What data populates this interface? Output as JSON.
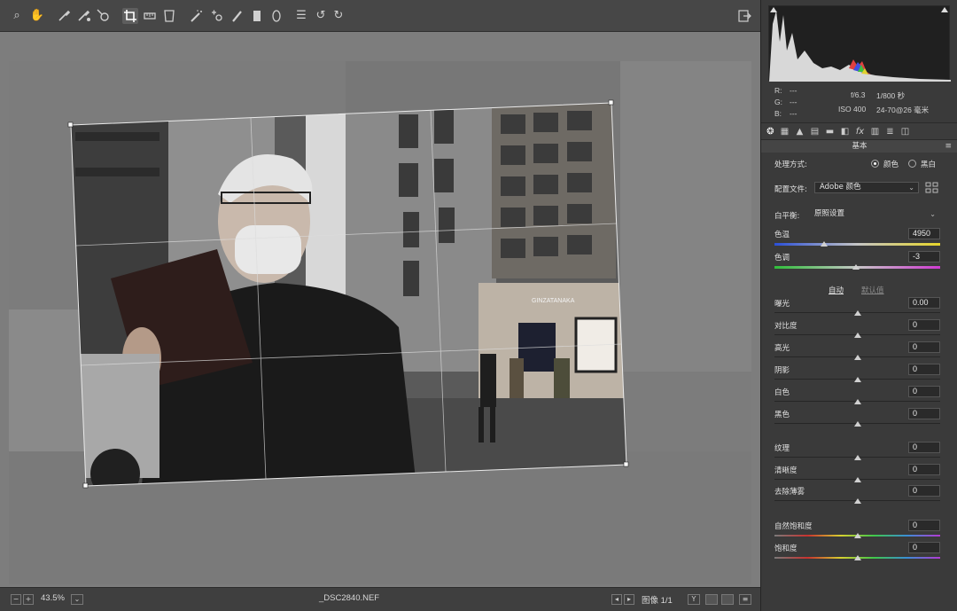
{
  "toolbar": {
    "tools": [
      {
        "name": "zoom-tool",
        "glyph": "⌕"
      },
      {
        "name": "hand-tool",
        "glyph": "✋"
      },
      {
        "name": "white-balance-tool",
        "glyph": "⟋"
      },
      {
        "name": "color-sampler-tool",
        "glyph": "⟋"
      },
      {
        "name": "targeted-adjustment-tool",
        "glyph": "⊹"
      },
      {
        "name": "crop-tool",
        "glyph": "⌗"
      },
      {
        "name": "straighten-tool",
        "glyph": "▭"
      },
      {
        "name": "transform-tool",
        "glyph": "⧈"
      },
      {
        "name": "spot-removal-tool",
        "glyph": "✎"
      },
      {
        "name": "red-eye-tool",
        "glyph": "⊕"
      },
      {
        "name": "adjustment-brush-tool",
        "glyph": "✐"
      },
      {
        "name": "graduated-filter-tool",
        "glyph": "▮"
      },
      {
        "name": "radial-filter-tool",
        "glyph": "◯"
      },
      {
        "name": "preferences-tool",
        "glyph": "☰"
      },
      {
        "name": "rotate-left-tool",
        "glyph": "↺"
      },
      {
        "name": "rotate-right-tool",
        "glyph": "↻"
      }
    ],
    "export_icon": "⇥"
  },
  "status": {
    "zoom": "43.5%",
    "filename": "_DSC2840.NEF",
    "image_counter": "图像 1/1"
  },
  "info": {
    "r": "R:",
    "g": "G:",
    "b": "B:",
    "r_val": "---",
    "g_val": "---",
    "b_val": "---",
    "aperture": "f/6.3",
    "shutter": "1/800 秒",
    "iso": "ISO 400",
    "lens": "24-70@26 毫米"
  },
  "panel": {
    "section_title": "基本",
    "treatment_label": "处理方式:",
    "treatment_color": "颜色",
    "treatment_bw": "黑白",
    "profile_label": "配置文件:",
    "profile_value": "Adobe 颜色",
    "wb_label": "白平衡:",
    "wb_value": "原照设置",
    "auto": "自动",
    "default": "默认值"
  },
  "sliders": [
    {
      "id": "temp",
      "label": "色温",
      "value": "4950",
      "frac": 0.3
    },
    {
      "id": "tint",
      "label": "色调",
      "value": "-3",
      "frac": 0.49
    },
    {
      "id": "exposure",
      "label": "曝光",
      "value": "0.00",
      "frac": 0.5
    },
    {
      "id": "contrast",
      "label": "对比度",
      "value": "0",
      "frac": 0.5
    },
    {
      "id": "highlights",
      "label": "高光",
      "value": "0",
      "frac": 0.5
    },
    {
      "id": "shadows",
      "label": "阴影",
      "value": "0",
      "frac": 0.5
    },
    {
      "id": "whites",
      "label": "白色",
      "value": "0",
      "frac": 0.5
    },
    {
      "id": "blacks",
      "label": "黑色",
      "value": "0",
      "frac": 0.5
    },
    {
      "id": "texture",
      "label": "纹理",
      "value": "0",
      "frac": 0.5
    },
    {
      "id": "clarity",
      "label": "清晰度",
      "value": "0",
      "frac": 0.5
    },
    {
      "id": "dehaze",
      "label": "去除薄雾",
      "value": "0",
      "frac": 0.5
    },
    {
      "id": "vibrance",
      "label": "自然饱和度",
      "value": "0",
      "frac": 0.5
    },
    {
      "id": "saturation",
      "label": "饱和度",
      "value": "0",
      "frac": 0.5
    }
  ],
  "photo": {
    "sign_text": "GINZATANAKA"
  },
  "colors": {
    "toolbar_bg": "#474747",
    "panel_bg": "#3a3a3a",
    "canvas_bg": "#7d7d7d"
  }
}
